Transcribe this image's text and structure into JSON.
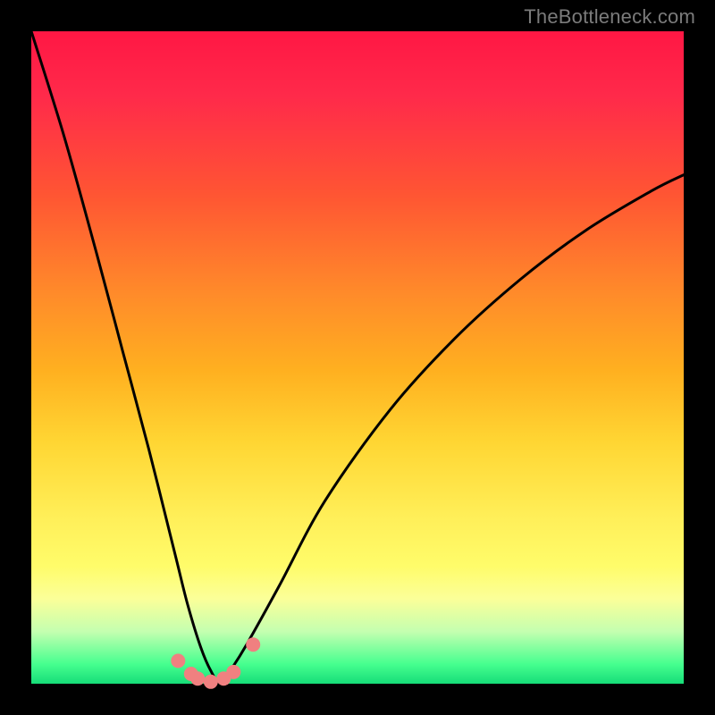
{
  "watermark": "TheBottleneck.com",
  "chart_data": {
    "type": "line",
    "title": "",
    "xlabel": "",
    "ylabel": "",
    "xlim": [
      0,
      1
    ],
    "ylim": [
      0,
      1
    ],
    "series": [
      {
        "name": "bottleneck-curve",
        "color": "#000000",
        "x": [
          0.0,
          0.05,
          0.1,
          0.14,
          0.18,
          0.22,
          0.24,
          0.26,
          0.275,
          0.29,
          0.305,
          0.33,
          0.38,
          0.45,
          0.55,
          0.65,
          0.75,
          0.85,
          0.95,
          1.0
        ],
        "y": [
          1.0,
          0.84,
          0.66,
          0.51,
          0.36,
          0.2,
          0.12,
          0.055,
          0.02,
          0.0,
          0.02,
          0.06,
          0.15,
          0.28,
          0.42,
          0.53,
          0.62,
          0.695,
          0.755,
          0.78
        ]
      }
    ],
    "markers": {
      "color": "#f08080",
      "points_x": [
        0.225,
        0.245,
        0.255,
        0.275,
        0.295,
        0.31,
        0.34
      ],
      "points_y": [
        0.035,
        0.015,
        0.008,
        0.003,
        0.008,
        0.018,
        0.06
      ]
    },
    "background_gradient": {
      "stops": [
        {
          "pos": 0.0,
          "color": "#ff1744"
        },
        {
          "pos": 0.25,
          "color": "#ff5533"
        },
        {
          "pos": 0.52,
          "color": "#ffb020"
        },
        {
          "pos": 0.75,
          "color": "#fff05a"
        },
        {
          "pos": 0.92,
          "color": "#c4ffb0"
        },
        {
          "pos": 1.0,
          "color": "#16dd78"
        }
      ]
    }
  }
}
